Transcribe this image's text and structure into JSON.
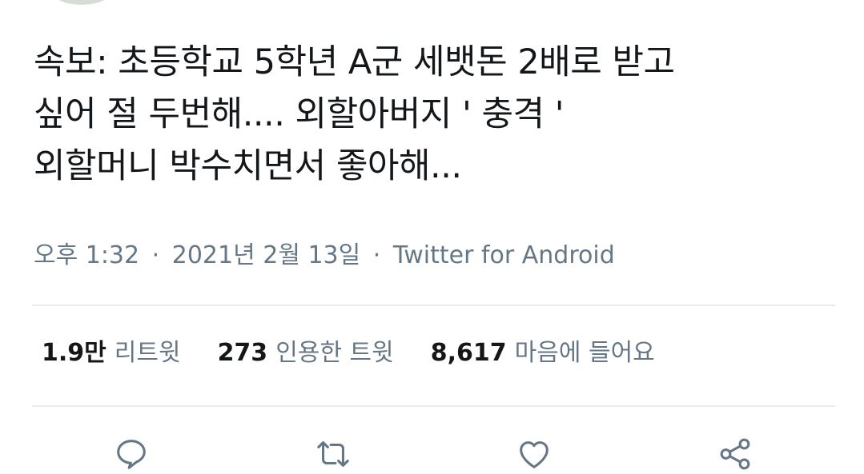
{
  "tweet": {
    "lines": [
      "속보: 초등학교 5학년 A군 세뱃돈 2배로 받고",
      "싶어 절 두번해.... 외할아버지 ' 충격 '",
      "외할머니 박수치면서 좋아해..."
    ]
  },
  "meta": {
    "time": "오후 1:32",
    "separator": "·",
    "date": "2021년 2월 13일",
    "source": "Twitter for Android"
  },
  "stats": {
    "retweets": {
      "count": "1.9만",
      "label": "리트윗"
    },
    "quotes": {
      "count": "273",
      "label": "인용한 트윗"
    },
    "likes": {
      "count": "8,617",
      "label": "마음에 들어요"
    }
  },
  "actions": {
    "reply_icon": "reply-icon",
    "retweet_icon": "retweet-icon",
    "like_icon": "heart-icon",
    "share_icon": "share-icon",
    "icon_color": "#657786"
  }
}
